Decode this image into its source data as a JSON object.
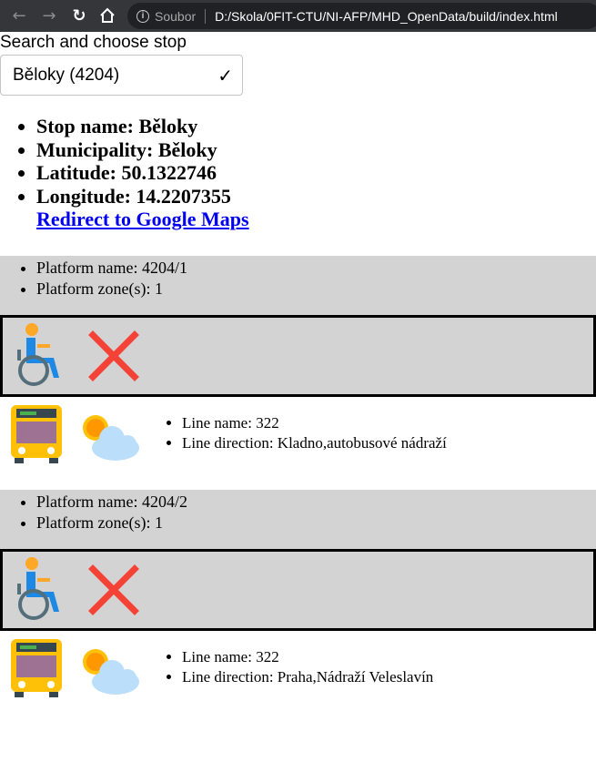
{
  "browser": {
    "site_label": "Soubor",
    "url": "D:/Skola/0FIT-CTU/NI-AFP/MHD_OpenData/build/index.html"
  },
  "search": {
    "title": "Search and choose stop",
    "selected": "Běloky (4204)"
  },
  "stop": {
    "name_line": "Stop name: Běloky",
    "municipality_line": "Municipality: Běloky",
    "latitude_line": "Latitude: 50.1322746",
    "longitude_line": "Longitude: 14.2207355",
    "maps_link": "Redirect to Google Maps"
  },
  "platforms": [
    {
      "name_line": "Platform name: 4204/1",
      "zone_line": "Platform zone(s): 1",
      "wheelchair_accessible": false,
      "line_name": "Line name: 322",
      "line_direction": "Line direction: Kladno,autobusové nádraží"
    },
    {
      "name_line": "Platform name: 4204/2",
      "zone_line": "Platform zone(s): 1",
      "wheelchair_accessible": false,
      "line_name": "Line name: 322",
      "line_direction": "Line direction: Praha,Nádraží Veleslavín"
    }
  ],
  "icons": {
    "back": "arrow-left-icon",
    "forward": "arrow-right-icon",
    "reload": "reload-icon",
    "home": "home-icon",
    "info": "info-icon",
    "wheelchair": "wheelchair-icon",
    "not_available": "cross-icon",
    "bus": "bus-icon",
    "weather": "sun-cloud-icon"
  },
  "colors": {
    "platform_bg": "#d3d3d3",
    "cross": "#f44336",
    "bus": "#ffc107",
    "link": "#0000ee"
  }
}
